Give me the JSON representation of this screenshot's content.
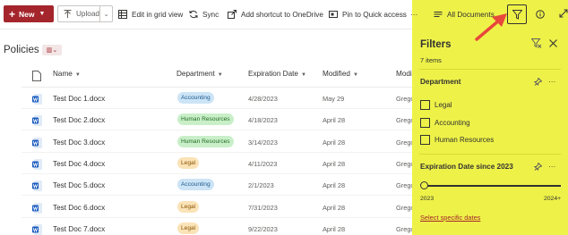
{
  "toolbar": {
    "new_label": "New",
    "upload_label": "Upload",
    "edit_grid_label": "Edit in grid view",
    "sync_label": "Sync",
    "shortcut_label": "Add shortcut to OneDrive",
    "pin_label": "Pin to Quick access",
    "more_label": "···",
    "view_label": "All Documents"
  },
  "library": {
    "title": "Policies"
  },
  "columns": {
    "name": "Name",
    "department": "Department",
    "expiration": "Expiration Date",
    "modified": "Modified",
    "modified_by": "Modi"
  },
  "rows": [
    {
      "name": "Test Doc 1.docx",
      "department": "Accounting",
      "expiration": "4/28/2023",
      "modified": "May 29",
      "modified_by": "Grego"
    },
    {
      "name": "Test Doc 2.docx",
      "department": "Human Resources",
      "expiration": "4/18/2023",
      "modified": "April 28",
      "modified_by": "Grego"
    },
    {
      "name": "Test Doc 3.docx",
      "department": "Human Resources",
      "expiration": "3/14/2023",
      "modified": "April 28",
      "modified_by": "Grego"
    },
    {
      "name": "Test Doc 4.docx",
      "department": "Legal",
      "expiration": "4/11/2023",
      "modified": "April 28",
      "modified_by": "Grego"
    },
    {
      "name": "Test Doc 5.docx",
      "department": "Accounting",
      "expiration": "2/1/2023",
      "modified": "April 28",
      "modified_by": "Grego"
    },
    {
      "name": "Test Doc 6.docx",
      "department": "Legal",
      "expiration": "7/31/2023",
      "modified": "April 28",
      "modified_by": "Grego"
    },
    {
      "name": "Test Doc 7.docx",
      "department": "Legal",
      "expiration": "9/22/2023",
      "modified": "April 28",
      "modified_by": "Grego"
    }
  ],
  "department_colors": {
    "Accounting": {
      "bg": "#cce4f6",
      "fg": "#1f5a8c"
    },
    "Human Resources": {
      "bg": "#c9efc9",
      "fg": "#226b22"
    },
    "Legal": {
      "bg": "#fbe3b8",
      "fg": "#8a5300"
    }
  },
  "filters": {
    "title": "Filters",
    "count": "7 items",
    "department": {
      "title": "Department",
      "options": [
        "Legal",
        "Accounting",
        "Human Resources"
      ]
    },
    "expiration": {
      "title": "Expiration Date since 2023",
      "min_label": "2023",
      "max_label": "2024+",
      "slider_value": 0
    },
    "link_label": "Select specific dates"
  },
  "colors": {
    "brand": "#a4262c",
    "highlight": "#eef248",
    "arrow": "#e8473b",
    "word_icon": "#185abd"
  }
}
